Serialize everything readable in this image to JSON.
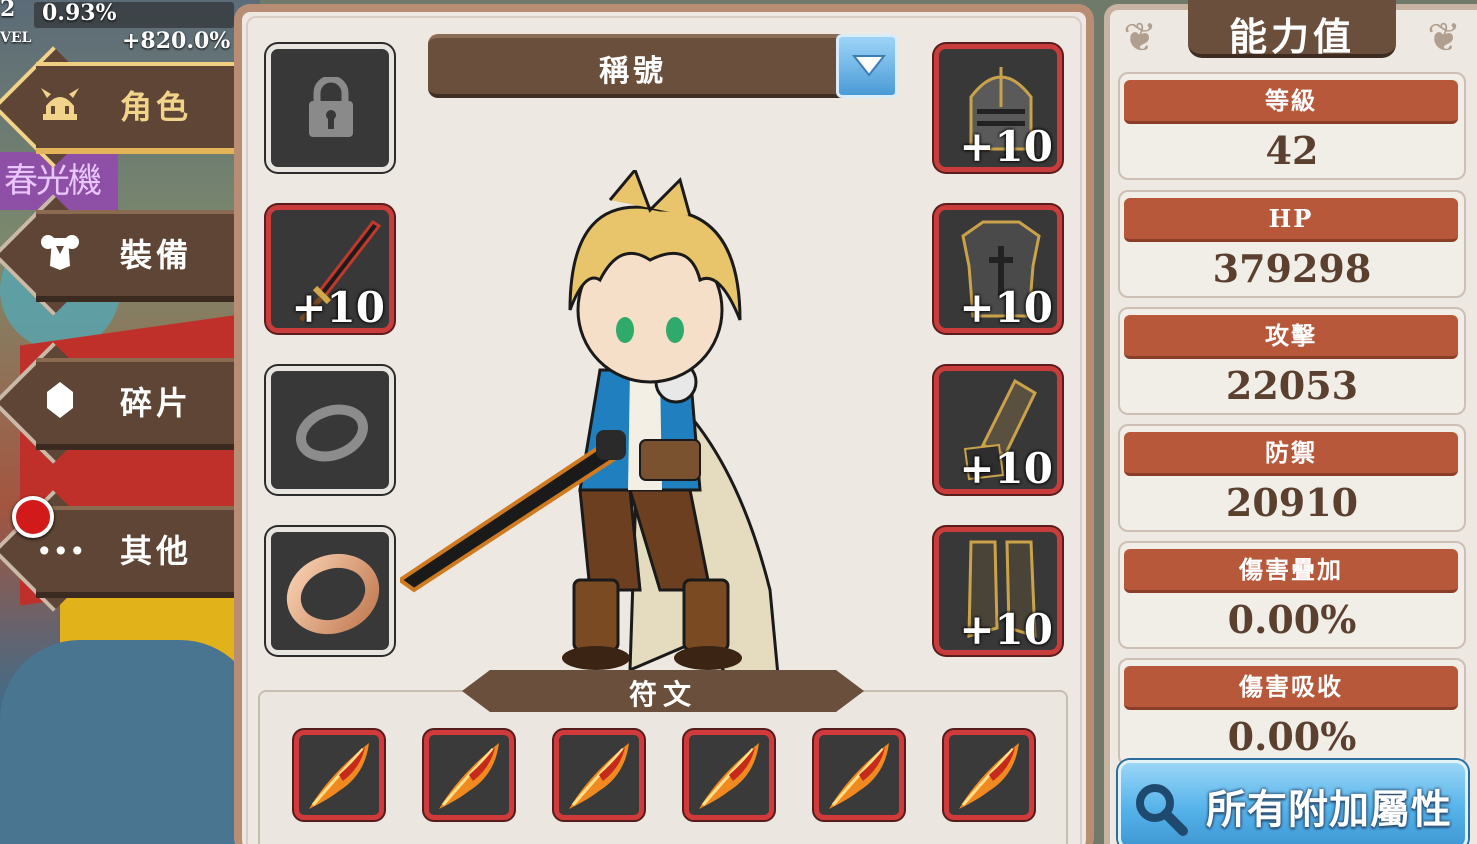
{
  "hud": {
    "level_number": "2",
    "level_badge": "VEL",
    "exp_percent": "0.93%",
    "exp_bonus": "+820.0%"
  },
  "background": {
    "sign_text": "春光機"
  },
  "tabs": [
    {
      "label": "角色",
      "icon": "helmet-icon",
      "active": true
    },
    {
      "label": "裝備",
      "icon": "armor-icon",
      "active": false
    },
    {
      "label": "碎片",
      "icon": "crystal-icon",
      "active": false
    },
    {
      "label": "其他",
      "icon": "more-icon",
      "active": false,
      "notification": true
    }
  ],
  "title_selector": {
    "label": "稱號"
  },
  "equipment": {
    "left": [
      {
        "slot": "locked",
        "icon": "lock-icon",
        "enhance": ""
      },
      {
        "slot": "weapon",
        "icon": "sword-icon",
        "enhance": "+10"
      },
      {
        "slot": "ring-empty",
        "icon": "ring-outline-icon",
        "enhance": ""
      },
      {
        "slot": "ring",
        "icon": "copper-ring-icon",
        "enhance": ""
      }
    ],
    "right": [
      {
        "slot": "helmet",
        "icon": "knight-helmet-icon",
        "enhance": "+10"
      },
      {
        "slot": "chest",
        "icon": "chest-armor-icon",
        "enhance": "+10"
      },
      {
        "slot": "gloves",
        "icon": "gauntlet-icon",
        "enhance": "+10"
      },
      {
        "slot": "boots",
        "icon": "greaves-icon",
        "enhance": "+10"
      }
    ]
  },
  "rune": {
    "title": "符文",
    "slots": [
      "fire-feather-icon",
      "fire-feather-icon",
      "fire-feather-icon",
      "fire-feather-icon",
      "fire-feather-icon",
      "fire-feather-icon"
    ]
  },
  "stats": {
    "title": "能力值",
    "items": [
      {
        "label": "等級",
        "value": "42"
      },
      {
        "label": "HP",
        "value": "379298"
      },
      {
        "label": "攻擊",
        "value": "22053"
      },
      {
        "label": "防禦",
        "value": "20910"
      },
      {
        "label": "傷害疊加",
        "value": "0.00%"
      },
      {
        "label": "傷害吸收",
        "value": "0.00%"
      }
    ],
    "all_button": "所有附加屬性"
  },
  "colors": {
    "panel_bg": "#ede8e1",
    "brown": "#6b4f3d",
    "stat_label": "#b8583b",
    "slot_red": "#c83c3c",
    "blue_button": "#55b3ea"
  }
}
